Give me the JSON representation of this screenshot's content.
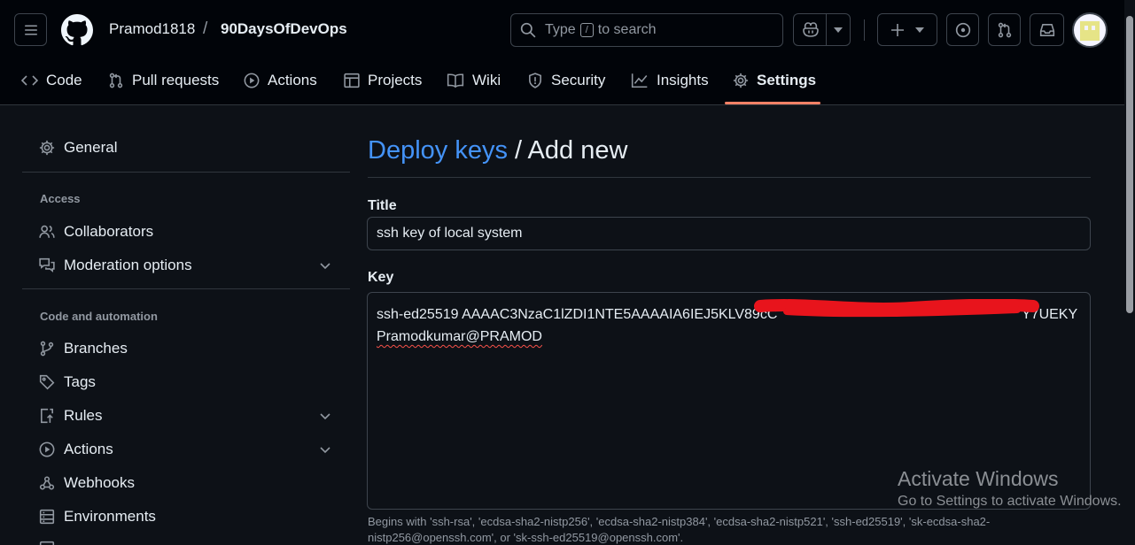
{
  "header": {
    "owner": "Pramod1818",
    "separator": "/",
    "repo": "90DaysOfDevOps",
    "search": {
      "prefix": "Type",
      "key": "/",
      "suffix": "to search"
    }
  },
  "tabs": [
    {
      "label": "Code",
      "icon": "code-icon"
    },
    {
      "label": "Pull requests",
      "icon": "git-pull-request-icon"
    },
    {
      "label": "Actions",
      "icon": "play-icon"
    },
    {
      "label": "Projects",
      "icon": "table-icon"
    },
    {
      "label": "Wiki",
      "icon": "book-icon"
    },
    {
      "label": "Security",
      "icon": "shield-icon"
    },
    {
      "label": "Insights",
      "icon": "graph-icon"
    },
    {
      "label": "Settings",
      "icon": "gear-icon",
      "selected": true
    }
  ],
  "sidebar": {
    "general": "General",
    "access_heading": "Access",
    "collaborators": "Collaborators",
    "moderation": "Moderation options",
    "code_heading": "Code and automation",
    "branches": "Branches",
    "tags": "Tags",
    "rules": "Rules",
    "actions": "Actions",
    "webhooks": "Webhooks",
    "environments": "Environments"
  },
  "main": {
    "title_link": "Deploy keys",
    "title_rest": "/ Add new",
    "title_label": "Title",
    "title_value": "ssh key of local system",
    "key_label": "Key",
    "key_line1": "ssh-ed25519 AAAAC3NzaC1lZDI1NTE5AAAAIA6IEJ5KLV89cC",
    "key_line1_tail": "Y7UEKY",
    "key_line2": "Pramodkumar@PRAMOD",
    "help_text": "Begins with 'ssh-rsa', 'ecdsa-sha2-nistp256', 'ecdsa-sha2-nistp384', 'ecdsa-sha2-nistp521', 'ssh-ed25519', 'sk-ecdsa-sha2-nistp256@openssh.com', or 'sk-ssh-ed25519@openssh.com'."
  },
  "watermark": {
    "line1": "Activate Windows",
    "line2": "Go to Settings to activate Windows."
  },
  "colors": {
    "background": "#0d1117",
    "header_bg": "#010409",
    "link": "#4493f8",
    "tab_underline": "#f78166",
    "redaction": "#e8141c"
  }
}
